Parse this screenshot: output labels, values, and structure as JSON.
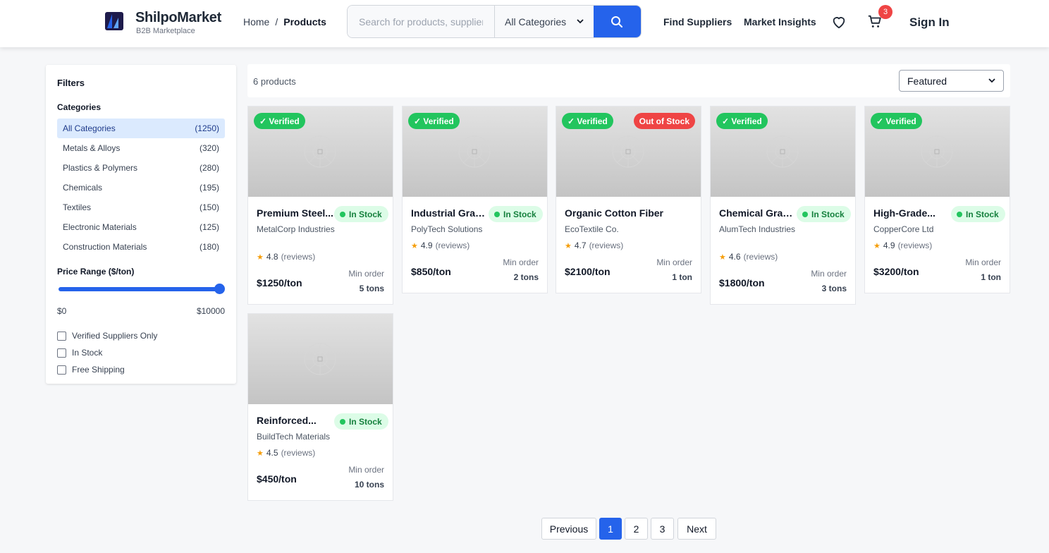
{
  "header": {
    "brand_name": "ShilpoMarket",
    "brand_tagline": "B2B Marketplace",
    "breadcrumb": [
      {
        "label": "Home"
      },
      {
        "separator": "/"
      },
      {
        "label": "Products"
      }
    ],
    "search": {
      "placeholder": "Search for products, suppliers...",
      "category": "All Categories"
    },
    "nav": {
      "find_suppliers": "Find Suppliers",
      "market_insights": "Market Insights"
    },
    "cart_count": "3",
    "sign_in": "Sign In",
    "icons": [
      "search-icon",
      "heart-icon",
      "cart-icon",
      "chevron-down-icon"
    ]
  },
  "filters": {
    "title": "Filters",
    "categories_title": "Categories",
    "categories": [
      {
        "label": "All Categories",
        "count": "(1250)"
      },
      {
        "label": "Metals & Alloys",
        "count": "(320)"
      },
      {
        "label": "Plastics & Polymers",
        "count": "(280)"
      },
      {
        "label": "Chemicals",
        "count": "(195)"
      },
      {
        "label": "Textiles",
        "count": "(150)"
      },
      {
        "label": "Electronic Materials",
        "count": "(125)"
      },
      {
        "label": "Construction Materials",
        "count": "(180)"
      }
    ],
    "price_title": "Price Range ($/ton)",
    "price_min": "$0",
    "price_max": "$10000",
    "price_range_value": 1.0,
    "checkboxes": [
      {
        "label": "Verified Suppliers Only"
      },
      {
        "label": "In Stock"
      },
      {
        "label": "Free Shipping"
      }
    ]
  },
  "toolbar": {
    "count": "6 products",
    "sort": "Featured"
  },
  "products": [
    {
      "name": "Premium Steel...",
      "verified": "✓ Verified",
      "status": "In Stock",
      "supplier": "MetalCorp Industries",
      "rating": "4.8",
      "reviews": "(reviews)",
      "price": "$1250/ton",
      "min_label": "Min order",
      "min_val": "5 tons"
    },
    {
      "name": "Industrial Grad...",
      "verified": "✓ Verified",
      "status": "In Stock",
      "supplier": "PolyTech Solutions",
      "rating": "4.9",
      "reviews": "(reviews)",
      "price": "$850/ton",
      "min_label": "Min order",
      "min_val": "2 tons"
    },
    {
      "name": "Organic Cotton Fiber",
      "verified": "✓ Verified",
      "status": "Out of Stock",
      "supplier": "EcoTextile Co.",
      "rating": "4.7",
      "reviews": "(reviews)",
      "price": "$2100/ton",
      "min_label": "Min order",
      "min_val": "1 ton"
    },
    {
      "name": "Chemical Grad...",
      "verified": "✓ Verified",
      "status": "In Stock",
      "supplier": "AlumTech Industries",
      "rating": "4.6",
      "reviews": "(reviews)",
      "price": "$1800/ton",
      "min_label": "Min order",
      "min_val": "3 tons"
    },
    {
      "name": "High-Grade...",
      "verified": "✓ Verified",
      "status": "In Stock",
      "supplier": "CopperCore Ltd",
      "rating": "4.9",
      "reviews": "(reviews)",
      "price": "$3200/ton",
      "min_label": "Min order",
      "min_val": "1 ton"
    },
    {
      "name": "Reinforced...",
      "verified": "",
      "status": "In Stock",
      "supplier": "BuildTech Materials",
      "rating": "4.5",
      "reviews": "(reviews)",
      "price": "$450/ton",
      "min_label": "Min order",
      "min_val": "10 tons"
    }
  ],
  "pagination": {
    "previous": "Previous",
    "pages": [
      "1",
      "2",
      "3"
    ],
    "next": "Next",
    "current": "1"
  },
  "colors": {
    "accent": "#2563eb",
    "verified": "#22c55e",
    "out_of_stock": "#ef4444",
    "in_stock_bg": "#dcfce7"
  }
}
